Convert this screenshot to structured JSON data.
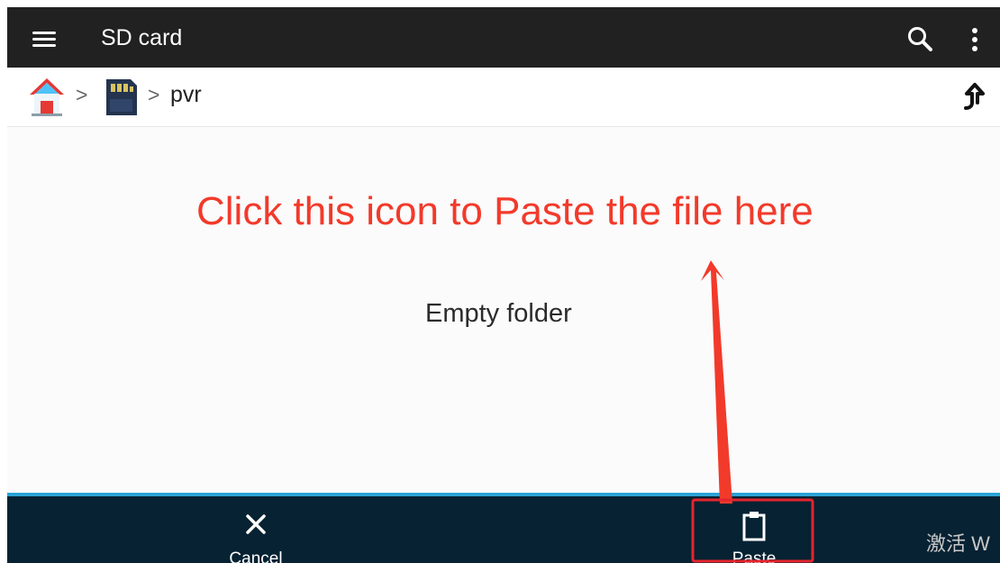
{
  "app": {
    "title": "SD card"
  },
  "toolbar": {
    "menu_icon": "menu-icon",
    "search_icon": "search-icon",
    "more_icon": "more-vertical-icon"
  },
  "breadcrumb": {
    "home_icon": "home-icon",
    "separator_1": ">",
    "sd_card_icon": "sd-card-icon",
    "separator_2": ">",
    "current_folder": "pvr",
    "up_icon": "up-arrow-icon"
  },
  "content": {
    "empty_message": "Empty folder"
  },
  "bottom_actions": {
    "cancel_label": "Cancel",
    "cancel_icon": "close-icon",
    "paste_label": "Paste",
    "paste_icon": "clipboard-icon"
  },
  "annotation": {
    "instruction": "Click this icon to Paste the file here",
    "color": "#f23a2b"
  },
  "overlay": {
    "watermark": "激活 W"
  },
  "theme": {
    "topbar": "#212121",
    "bottom_bar": "#062233",
    "bottom_bar_accent": "#2aa3d7",
    "background": "#fbfbfb"
  }
}
